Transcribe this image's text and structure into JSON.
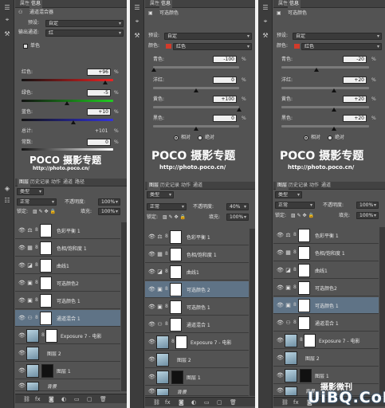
{
  "watermark": {
    "brand": "POCO 摄影专题",
    "url": "http://photo.poco.cn/"
  },
  "site_watermark": {
    "text": "摄影微刊",
    "logo": "UiBQ.CoM"
  },
  "colors": {
    "accent_red": "#d23b2b",
    "selected_layer": "#5f7386"
  },
  "props_tabs": [
    "属性",
    "信息"
  ],
  "layers_tabs": [
    "图层",
    "历史记录",
    "动作",
    "通道",
    "路径"
  ],
  "layers_tabs_short": [
    "图层",
    "历史记录",
    "动作",
    "通道"
  ],
  "layers_toolbar": {
    "kind": "类型",
    "mode": "正常",
    "opacity_label": "不透明度:",
    "fill_label": "填充:",
    "lock_label": "锁定:"
  },
  "panel1": {
    "title": "通道混合器",
    "preset_label": "预设:",
    "preset_value": "自定",
    "channel_label": "输出通道:",
    "channel_value": "红",
    "mono_label": "单色",
    "sliders": [
      {
        "label": "红色:",
        "value": "+96",
        "pct": "%"
      },
      {
        "label": "绿色:",
        "value": "-5",
        "pct": "%"
      },
      {
        "label": "蓝色:",
        "value": "+10",
        "pct": "%"
      }
    ],
    "total_label": "总计:",
    "total_value": "+101",
    "constant_label": "常数:",
    "constant_value": "0",
    "opacity_value": "100%",
    "fill_value": "100%",
    "layers": [
      "色彩平衡 1",
      "色相/饱和度 1",
      "曲线1",
      "可选颜色2",
      "可选颜色 1",
      "通道混合 1",
      "Exposure 7 - 电影",
      "图层 2",
      "图层 1",
      "背景"
    ]
  },
  "panel2": {
    "title": "可选颜色",
    "preset_label": "预设:",
    "preset_value": "自定",
    "color_label": "颜色:",
    "color_value": "红色",
    "sliders": [
      {
        "label": "青色:",
        "value": "-100",
        "pct": "%"
      },
      {
        "label": "洋红:",
        "value": "0",
        "pct": "%"
      },
      {
        "label": "黄色:",
        "value": "+100",
        "pct": "%"
      },
      {
        "label": "黑色:",
        "value": "0",
        "pct": "%"
      }
    ],
    "radio1": "相对",
    "radio2": "绝对",
    "opacity_value": "40%",
    "fill_value": "100%",
    "layers": [
      "色彩平衡 1",
      "色相/饱和度 1",
      "曲线1",
      "可选颜色 2",
      "可选颜色 1",
      "通道混合 1",
      "Exposure 7 - 电影",
      "图层 2",
      "图层 1",
      "背景"
    ]
  },
  "panel3": {
    "title": "可选颜色",
    "preset_label": "预设:",
    "preset_value": "自定",
    "color_label": "颜色:",
    "color_value": "红色",
    "sliders": [
      {
        "label": "青色:",
        "value": "-20",
        "pct": "%"
      },
      {
        "label": "洋红:",
        "value": "+20",
        "pct": "%"
      },
      {
        "label": "黄色:",
        "value": "+20",
        "pct": "%"
      },
      {
        "label": "黑色:",
        "value": "+20",
        "pct": "%"
      }
    ],
    "radio1": "相对",
    "radio2": "绝对",
    "opacity_value": "100%",
    "fill_value": "100%",
    "layers": [
      "色彩平衡 1",
      "色相/饱和度 1",
      "曲线1",
      "可选颜色2",
      "可选颜色 1",
      "通道混合 1",
      "Exposure 7 - 电影",
      "图层 2",
      "图层 1",
      "背景"
    ]
  }
}
